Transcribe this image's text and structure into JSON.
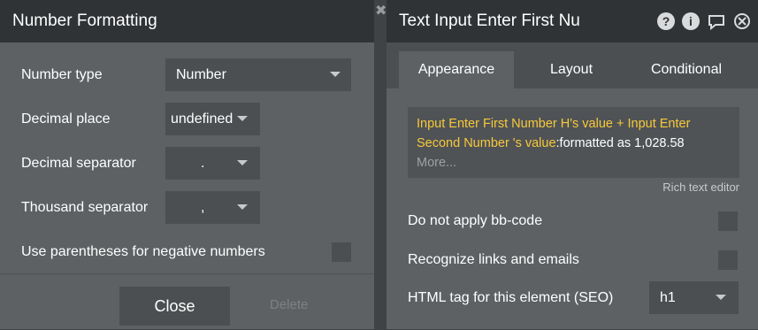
{
  "left_panel": {
    "title": "Number Formatting",
    "fields": [
      {
        "label": "Number type",
        "value": "Number"
      },
      {
        "label": "Decimal place",
        "value": "undefined"
      },
      {
        "label": "Decimal separator",
        "value": "."
      },
      {
        "label": "Thousand separator",
        "value": ","
      },
      {
        "label": "Use parentheses for negative numbers"
      }
    ],
    "close_label": "Close",
    "delete_label": "Delete"
  },
  "right_panel": {
    "title": "Text Input Enter First Nu",
    "icons": [
      "help-icon",
      "info-icon",
      "comment-icon",
      "close-icon"
    ],
    "tabs": [
      "Appearance",
      "Layout",
      "Conditional"
    ],
    "expression": {
      "part1": "Input Enter First Number H's value + Input Enter Second Number 's value",
      "part2": ":formatted as 1,028.58",
      "more": "More..."
    },
    "rich_text_editor": "Rich text editor",
    "options": [
      {
        "label": "Do not apply bb-code"
      },
      {
        "label": "Recognize links and emails"
      },
      {
        "label": "HTML tag for this element (SEO)",
        "value": "h1"
      }
    ]
  }
}
